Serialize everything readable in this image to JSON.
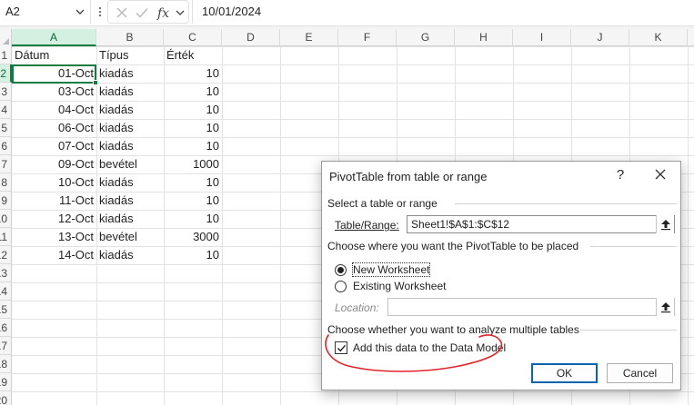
{
  "formula_bar": {
    "name_box": "A2",
    "cancel_icon": "close-icon",
    "enter_icon": "checkmark-icon",
    "function_icon": "fx",
    "formula_value": "10/01/2024"
  },
  "grid": {
    "columns": [
      "A",
      "B",
      "C",
      "D",
      "E",
      "F",
      "G",
      "H",
      "I",
      "J",
      "K"
    ],
    "rows": [
      "1",
      "2",
      "3",
      "4",
      "5",
      "6",
      "7",
      "8",
      "9",
      "10",
      "11",
      "12",
      "13",
      "14",
      "15",
      "16",
      "17",
      "18",
      "19",
      "20"
    ],
    "active_cell": "A2",
    "headers": {
      "a": "Dátum",
      "b": "Típus",
      "c": "Érték"
    },
    "data": [
      {
        "date": "01-Oct",
        "type": "kiadás",
        "value": "10"
      },
      {
        "date": "03-Oct",
        "type": "kiadás",
        "value": "10"
      },
      {
        "date": "04-Oct",
        "type": "kiadás",
        "value": "10"
      },
      {
        "date": "06-Oct",
        "type": "kiadás",
        "value": "10"
      },
      {
        "date": "07-Oct",
        "type": "kiadás",
        "value": "10"
      },
      {
        "date": "09-Oct",
        "type": "bevétel",
        "value": "1000"
      },
      {
        "date": "10-Oct",
        "type": "kiadás",
        "value": "10"
      },
      {
        "date": "11-Oct",
        "type": "kiadás",
        "value": "10"
      },
      {
        "date": "12-Oct",
        "type": "kiadás",
        "value": "10"
      },
      {
        "date": "13-Oct",
        "type": "bevétel",
        "value": "3000"
      },
      {
        "date": "14-Oct",
        "type": "kiadás",
        "value": "10"
      }
    ]
  },
  "dialog": {
    "title": "PivotTable from table or range",
    "help": "?",
    "close_icon": "close-icon",
    "section_source": "Select a table or range",
    "table_range_label": "Table/Range:",
    "table_range_value": "Sheet1!$A$1:$C$12",
    "section_placement": "Choose where you want the PivotTable to be placed",
    "new_worksheet": "New Worksheet",
    "existing_worksheet": "Existing Worksheet",
    "location_label": "Location:",
    "location_value": "",
    "section_multiple": "Choose whether you want to analyze multiple tables",
    "add_data_model": "Add this data to the Data Model",
    "add_data_model_checked": true,
    "new_worksheet_selected": true,
    "ok": "OK",
    "cancel": "Cancel"
  },
  "colors": {
    "excel_green": "#107c41",
    "annotation_red": "#e0242c",
    "button_focus": "#0a64ad"
  }
}
